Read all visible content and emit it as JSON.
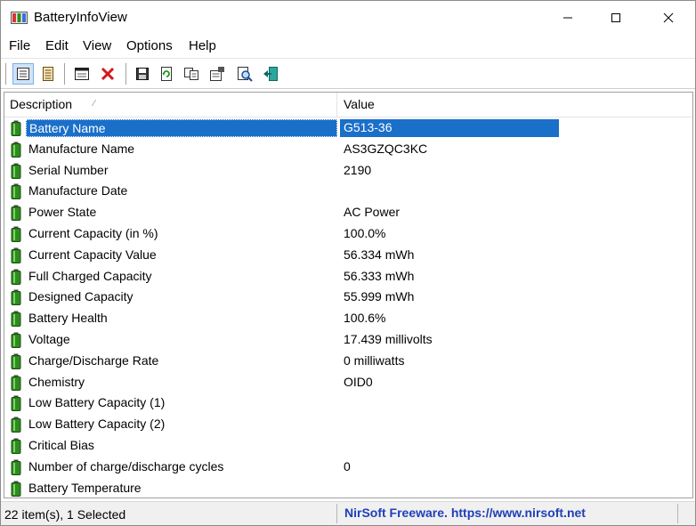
{
  "window": {
    "title": "BatteryInfoView"
  },
  "menu": {
    "items": [
      "File",
      "Edit",
      "View",
      "Options",
      "Help"
    ]
  },
  "toolbar": {
    "buttons": [
      {
        "icon": "details-view-icon",
        "active": true
      },
      {
        "icon": "list-view-icon",
        "active": false
      },
      {
        "icon": "window-properties-icon",
        "active": false
      },
      {
        "icon": "delete-x-icon",
        "active": false
      },
      {
        "icon": "save-floppy-icon",
        "active": false
      },
      {
        "icon": "refresh-icon",
        "active": false
      },
      {
        "icon": "copy-icon",
        "active": false
      },
      {
        "icon": "properties-icon",
        "active": false
      },
      {
        "icon": "find-icon",
        "active": false
      },
      {
        "icon": "exit-door-icon",
        "active": false
      }
    ]
  },
  "list": {
    "columns": {
      "description": "Description",
      "value": "Value"
    },
    "rows": [
      {
        "description": "Battery Name",
        "value": "G513-36",
        "selected": true
      },
      {
        "description": "Manufacture Name",
        "value": "AS3GZQC3KC"
      },
      {
        "description": "Serial Number",
        "value": "2190"
      },
      {
        "description": "Manufacture Date",
        "value": ""
      },
      {
        "description": "Power State",
        "value": "AC Power"
      },
      {
        "description": "Current Capacity (in %)",
        "value": "100.0%"
      },
      {
        "description": "Current Capacity Value",
        "value": "56.334 mWh"
      },
      {
        "description": "Full Charged Capacity",
        "value": "56.333 mWh"
      },
      {
        "description": "Designed Capacity",
        "value": "55.999 mWh"
      },
      {
        "description": "Battery Health",
        "value": "100.6%"
      },
      {
        "description": "Voltage",
        "value": "17.439 millivolts"
      },
      {
        "description": "Charge/Discharge Rate",
        "value": "0 milliwatts"
      },
      {
        "description": "Chemistry",
        "value": "OID0"
      },
      {
        "description": "Low Battery Capacity (1)",
        "value": ""
      },
      {
        "description": "Low Battery Capacity (2)",
        "value": ""
      },
      {
        "description": "Critical Bias",
        "value": ""
      },
      {
        "description": "Number of charge/discharge cycles",
        "value": "0"
      },
      {
        "description": "Battery Temperature",
        "value": ""
      }
    ]
  },
  "status": {
    "items_text": "22 item(s), 1 Selected",
    "credit_text": "NirSoft Freeware. https://www.nirsoft.net"
  },
  "colors": {
    "selection": "#1a6fc9",
    "credit_link": "#1e3fb8",
    "battery_green": "#2e8b1e"
  }
}
